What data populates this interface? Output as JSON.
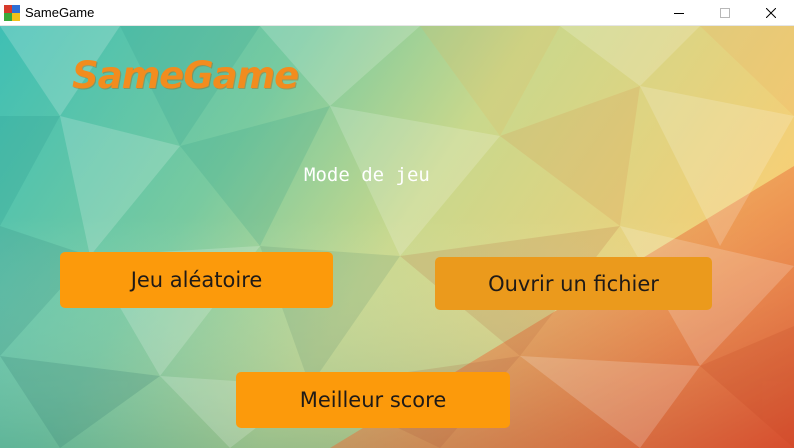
{
  "window": {
    "title": "SameGame",
    "icon": "samegame-app-icon",
    "controls": {
      "minimize_icon": "minimize-icon",
      "maximize_icon": "maximize-icon",
      "close_icon": "close-icon"
    }
  },
  "main": {
    "logo_text": "SameGame",
    "mode_label": "Mode de jeu",
    "buttons": {
      "random": "Jeu aléatoire",
      "open_file": "Ouvrir un fichier",
      "best_score": "Meilleur score"
    }
  },
  "colors": {
    "logo": "#f28c1e",
    "button": "#fc9a0b",
    "button_text": "#1f1a17",
    "background_left": "#3fbfb0",
    "background_top_right": "#f6d57a",
    "background_bottom_right": "#e4582c"
  }
}
